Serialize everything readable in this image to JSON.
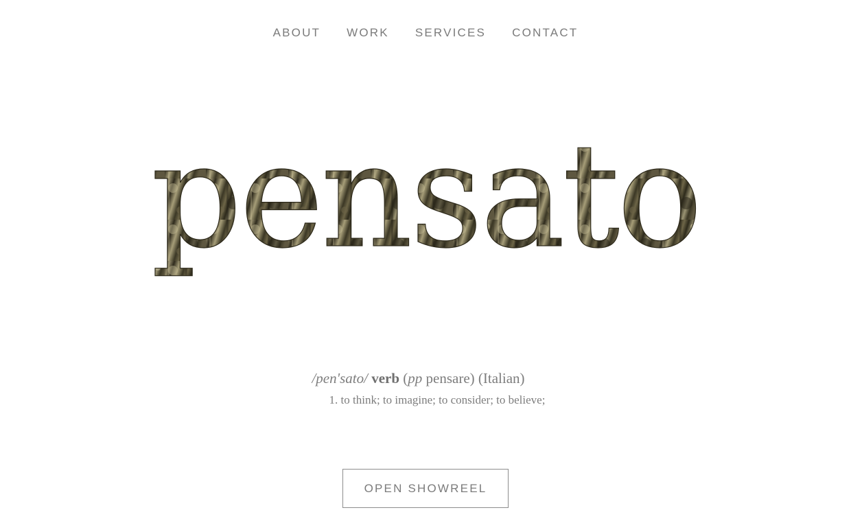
{
  "nav": {
    "items": [
      {
        "label": "ABOUT"
      },
      {
        "label": "WORK"
      },
      {
        "label": "SERVICES"
      },
      {
        "label": "CONTACT"
      }
    ]
  },
  "hero": {
    "word": "pensato"
  },
  "definition": {
    "phonetic": "/pen'sato/",
    "part_of_speech": "verb",
    "paren_open": "(",
    "pp_abbrev": "pp",
    "root_word": " pensare)",
    "language": "(Italian)",
    "sense_1": "1. to think; to imagine; to consider; to believe;"
  },
  "cta": {
    "label": "OPEN SHOWREEL"
  },
  "colors": {
    "text": "#7b7b7b",
    "background": "#ffffff",
    "hero_texture_base": "#4a4432",
    "hero_texture_light": "#c9bf98",
    "hero_texture_dark": "#2a2719"
  }
}
